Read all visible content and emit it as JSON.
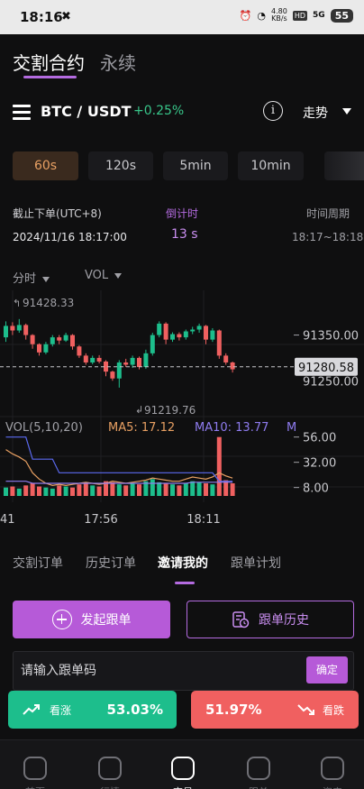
{
  "status_bar": {
    "time": "18:16",
    "net_speed_value": "4.80",
    "net_speed_unit": "KB/s",
    "hd": "HD",
    "signal": "5G",
    "battery": "55"
  },
  "top_tabs": [
    {
      "label": "交割合约",
      "active": true
    },
    {
      "label": "永续",
      "active": false
    }
  ],
  "pair": {
    "name": "BTC / USDT",
    "change": "+0.25%",
    "trend_label": "走势"
  },
  "periods": [
    {
      "label": "60s",
      "active": true
    },
    {
      "label": "120s",
      "active": false
    },
    {
      "label": "5min",
      "active": false
    },
    {
      "label": "10min",
      "active": false
    }
  ],
  "info": {
    "deadline_label": "截止下单(UTC+8)",
    "deadline_value": "2024/11/16 18:17:00",
    "countdown_label": "倒计时",
    "countdown_value": "13 s",
    "period_label": "时间周期",
    "period_value": "18:17~18:18"
  },
  "chart_controls": {
    "timeframe": "分时",
    "indicator": "VOL"
  },
  "chart_data": {
    "type": "candlestick",
    "price_ticks": [
      "91350.00",
      "91280.58",
      "91250.00"
    ],
    "current_price": "91280.58",
    "high_label": "91428.33",
    "low_label": "91219.76",
    "volume_header": "VOL(5,10,20)",
    "ma5": "MA5: 17.12",
    "ma10": "MA10: 13.77",
    "ma20_partial": "M",
    "volume_ticks": [
      "56.00",
      "32.00",
      "8.00"
    ],
    "x_ticks": [
      "41",
      "17:56",
      "18:11"
    ],
    "candles": [
      {
        "o": 91345,
        "c": 91370,
        "h": 91380,
        "l": 91335
      },
      {
        "o": 91370,
        "c": 91360,
        "h": 91378,
        "l": 91350
      },
      {
        "o": 91360,
        "c": 91372,
        "h": 91385,
        "l": 91355
      },
      {
        "o": 91372,
        "c": 91350,
        "h": 91375,
        "l": 91340
      },
      {
        "o": 91350,
        "c": 91330,
        "h": 91352,
        "l": 91320
      },
      {
        "o": 91330,
        "c": 91312,
        "h": 91332,
        "l": 91305
      },
      {
        "o": 91312,
        "c": 91330,
        "h": 91335,
        "l": 91308
      },
      {
        "o": 91330,
        "c": 91345,
        "h": 91350,
        "l": 91325
      },
      {
        "o": 91345,
        "c": 91338,
        "h": 91350,
        "l": 91330
      },
      {
        "o": 91338,
        "c": 91350,
        "h": 91355,
        "l": 91335
      },
      {
        "o": 91350,
        "c": 91325,
        "h": 91352,
        "l": 91318
      },
      {
        "o": 91325,
        "c": 91305,
        "h": 91328,
        "l": 91300
      },
      {
        "o": 91305,
        "c": 91290,
        "h": 91310,
        "l": 91285
      },
      {
        "o": 91290,
        "c": 91300,
        "h": 91305,
        "l": 91286
      },
      {
        "o": 91300,
        "c": 91292,
        "h": 91306,
        "l": 91288
      },
      {
        "o": 91292,
        "c": 91270,
        "h": 91295,
        "l": 91260
      },
      {
        "o": 91270,
        "c": 91255,
        "h": 91272,
        "l": 91250
      },
      {
        "o": 91255,
        "c": 91290,
        "h": 91295,
        "l": 91235
      },
      {
        "o": 91290,
        "c": 91285,
        "h": 91298,
        "l": 91280
      },
      {
        "o": 91285,
        "c": 91300,
        "h": 91305,
        "l": 91278
      },
      {
        "o": 91300,
        "c": 91280,
        "h": 91303,
        "l": 91275
      },
      {
        "o": 91280,
        "c": 91310,
        "h": 91318,
        "l": 91276
      },
      {
        "o": 91310,
        "c": 91350,
        "h": 91355,
        "l": 91305
      },
      {
        "o": 91350,
        "c": 91375,
        "h": 91380,
        "l": 91345
      },
      {
        "o": 91375,
        "c": 91340,
        "h": 91378,
        "l": 91330
      },
      {
        "o": 91340,
        "c": 91352,
        "h": 91356,
        "l": 91335
      },
      {
        "o": 91352,
        "c": 91345,
        "h": 91356,
        "l": 91338
      },
      {
        "o": 91345,
        "c": 91358,
        "h": 91362,
        "l": 91340
      },
      {
        "o": 91358,
        "c": 91362,
        "h": 91368,
        "l": 91352
      },
      {
        "o": 91362,
        "c": 91370,
        "h": 91375,
        "l": 91355
      },
      {
        "o": 91370,
        "c": 91340,
        "h": 91372,
        "l": 91330
      },
      {
        "o": 91340,
        "c": 91360,
        "h": 91365,
        "l": 91335
      },
      {
        "o": 91360,
        "c": 91305,
        "h": 91362,
        "l": 91298
      },
      {
        "o": 91305,
        "c": 91290,
        "h": 91310,
        "l": 91285
      },
      {
        "o": 91290,
        "c": 91275,
        "h": 91292,
        "l": 91268
      }
    ],
    "volumes": [
      8,
      9,
      7,
      10,
      12,
      9,
      8,
      7,
      10,
      9,
      8,
      11,
      12,
      10,
      9,
      14,
      13,
      11,
      10,
      12,
      11,
      14,
      16,
      13,
      12,
      11,
      10,
      12,
      14,
      13,
      12,
      11,
      56,
      15,
      12
    ],
    "ma_orange": [
      44,
      40,
      37,
      33,
      22,
      16,
      12,
      10,
      11,
      10,
      11,
      12,
      13,
      12,
      11,
      12,
      14,
      13,
      12,
      13,
      14,
      15,
      17,
      16,
      15,
      14,
      14,
      16,
      18,
      17,
      16,
      18,
      22,
      19,
      17
    ],
    "ma_blue": [
      56,
      56,
      56,
      56,
      35,
      35,
      35,
      35,
      22,
      22,
      22,
      22,
      22,
      22,
      22,
      22,
      22,
      22,
      22,
      22,
      22,
      22,
      22,
      22,
      22,
      22,
      22,
      22,
      22,
      22,
      22,
      22,
      14,
      14,
      14
    ],
    "ma_purple": [
      14,
      14,
      14,
      14,
      12,
      12,
      12,
      12,
      12,
      12,
      12,
      12,
      12,
      12,
      12,
      12,
      12,
      12,
      12,
      12,
      12,
      12,
      12,
      12,
      12,
      12,
      12,
      12,
      13,
      13,
      13,
      13,
      13,
      13,
      13
    ]
  },
  "order_tabs": [
    {
      "label": "交割订单",
      "active": false
    },
    {
      "label": "历史订单",
      "active": false
    },
    {
      "label": "邀请我的",
      "active": true
    },
    {
      "label": "跟单计划",
      "active": false
    }
  ],
  "copy_actions": {
    "start_label": "发起跟单",
    "history_label": "跟单历史"
  },
  "code_input": {
    "placeholder": "请输入跟单码",
    "value": "",
    "confirm_label": "确定"
  },
  "trade": {
    "rise_label": "看涨",
    "rise_pct": "53.03%",
    "fall_pct": "51.97%",
    "fall_label": "看跌"
  },
  "bottom_nav": [
    {
      "label": "首页",
      "icon": "home-icon",
      "active": false
    },
    {
      "label": "行情",
      "icon": "chart-icon",
      "active": false
    },
    {
      "label": "交易",
      "icon": "trade-icon",
      "active": true
    },
    {
      "label": "跟单",
      "icon": "copy-icon",
      "active": false
    },
    {
      "label": "资产",
      "icon": "wallet-icon",
      "active": false
    }
  ],
  "colors": {
    "accent": "#b65ad8",
    "up": "#1dbe8c",
    "down": "#f06060",
    "ma5": "#e8a063",
    "ma10": "#8f7cf0"
  }
}
